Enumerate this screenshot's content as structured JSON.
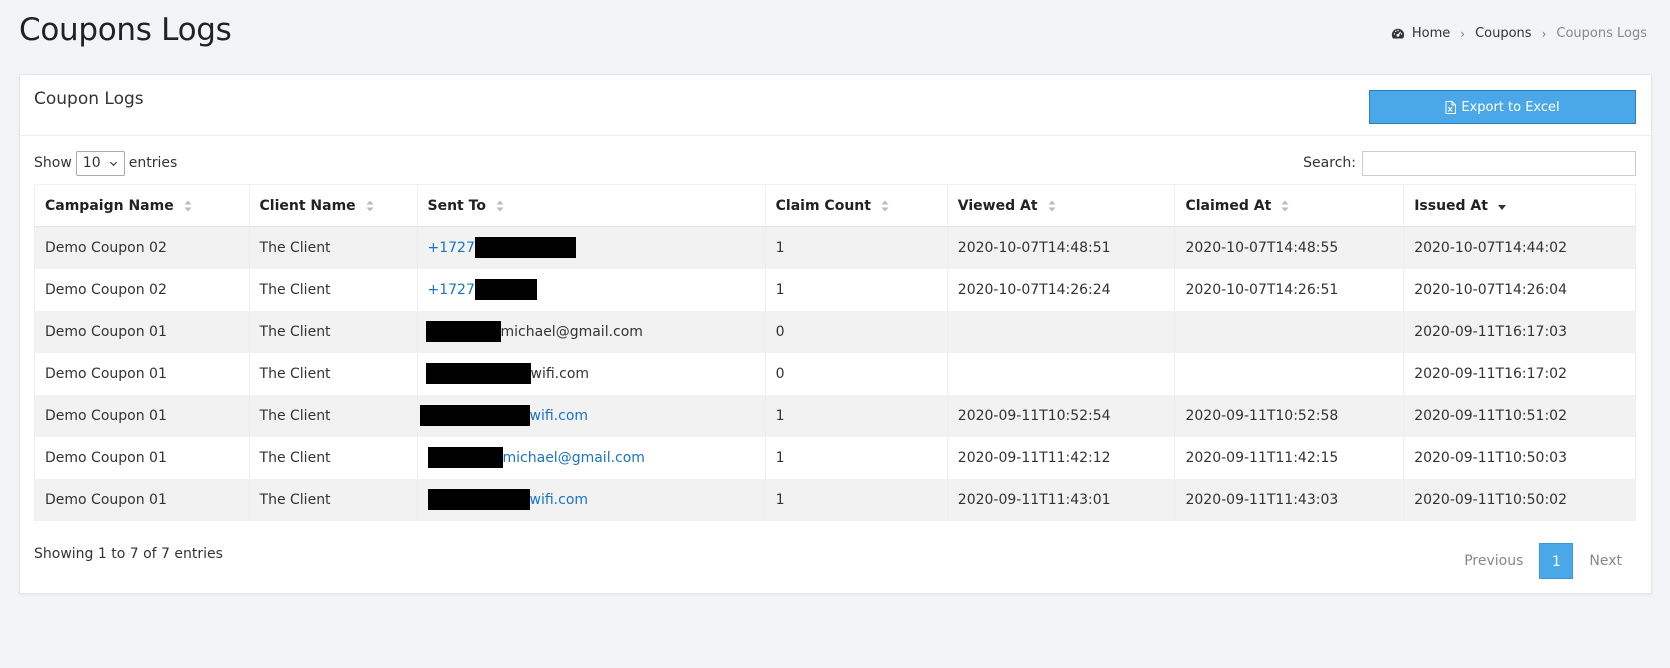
{
  "header": {
    "title": "Coupons Logs",
    "breadcrumb": [
      "Home",
      "Coupons",
      "Coupons Logs"
    ],
    "breadcrumb_icon": "dashboard-icon"
  },
  "card": {
    "title": "Coupon Logs",
    "export_label": "Export to Excel",
    "export_icon": "file-excel-icon"
  },
  "controls": {
    "show_label": "Show",
    "entries_label": "entries",
    "page_size": "10",
    "search_label": "Search:",
    "search_value": ""
  },
  "table": {
    "columns": [
      "Campaign Name",
      "Client Name",
      "Sent To",
      "Claim Count",
      "Viewed At",
      "Claimed At",
      "Issued At"
    ],
    "sorted_column": "Issued At",
    "sort_direction": "desc",
    "rows": [
      {
        "campaign": "Demo Coupon 02",
        "client": "The Client",
        "sent_prefix": "+1727",
        "sent_suffix": "",
        "sent_link": true,
        "claims": "1",
        "viewed": "2020-10-07T14:48:51",
        "claimed": "2020-10-07T14:48:55",
        "issued": "2020-10-07T14:44:02"
      },
      {
        "campaign": "Demo Coupon 02",
        "client": "The Client",
        "sent_prefix": "+1727",
        "sent_suffix": "",
        "sent_link": true,
        "claims": "1",
        "viewed": "2020-10-07T14:26:24",
        "claimed": "2020-10-07T14:26:51",
        "issued": "2020-10-07T14:26:04"
      },
      {
        "campaign": "Demo Coupon 01",
        "client": "The Client",
        "sent_prefix": "",
        "sent_suffix": "michael@gmail.com",
        "sent_link": false,
        "claims": "0",
        "viewed": "",
        "claimed": "",
        "issued": "2020-09-11T16:17:03"
      },
      {
        "campaign": "Demo Coupon 01",
        "client": "The Client",
        "sent_prefix": "",
        "sent_suffix": "wifi.com",
        "sent_link": false,
        "claims": "0",
        "viewed": "",
        "claimed": "",
        "issued": "2020-09-11T16:17:02"
      },
      {
        "campaign": "Demo Coupon 01",
        "client": "The Client",
        "sent_prefix": "",
        "sent_suffix": "wifi.com",
        "sent_link": true,
        "claims": "1",
        "viewed": "2020-09-11T10:52:54",
        "claimed": "2020-09-11T10:52:58",
        "issued": "2020-09-11T10:51:02"
      },
      {
        "campaign": "Demo Coupon 01",
        "client": "The Client",
        "sent_prefix": "",
        "sent_suffix": "michael@gmail.com",
        "sent_link": true,
        "claims": "1",
        "viewed": "2020-09-11T11:42:12",
        "claimed": "2020-09-11T11:42:15",
        "issued": "2020-09-11T10:50:03"
      },
      {
        "campaign": "Demo Coupon 01",
        "client": "The Client",
        "sent_prefix": "",
        "sent_suffix": "wifi.com",
        "sent_link": true,
        "claims": "1",
        "viewed": "2020-09-11T11:43:01",
        "claimed": "2020-09-11T11:43:03",
        "issued": "2020-09-11T10:50:02"
      }
    ]
  },
  "footer": {
    "info": "Showing 1 to 7 of 7 entries",
    "prev_label": "Previous",
    "current_page": "1",
    "next_label": "Next"
  },
  "colors": {
    "accent": "#4aa8e8",
    "link": "#1a73c8",
    "background": "#f2f4f7"
  }
}
